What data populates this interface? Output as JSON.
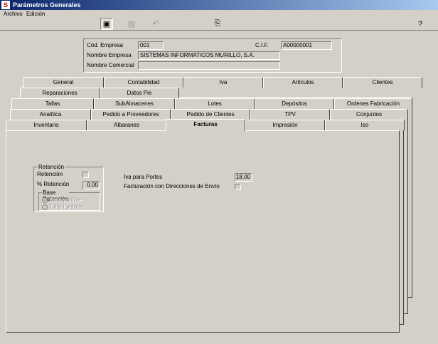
{
  "window": {
    "title": "Parámetros Generales"
  },
  "menu": {
    "archivo": "Archivo",
    "edicion": "Edición"
  },
  "toolbar": {
    "icons": [
      "save-exit-icon",
      "floppy-disk-icon",
      "undo-icon",
      "exit-door-icon",
      "help-icon"
    ]
  },
  "company": {
    "cod_label": "Cód. Empresa",
    "cod_value": "001",
    "cif_label": "C.I.F.",
    "cif_value": "A00000001",
    "name_label": "Nombre Empresa",
    "name_value": "SISTEMAS INFORMATICOS MURILLO, S.A.",
    "commercial_label": "Nombre Comercial",
    "commercial_value": ""
  },
  "tabs": {
    "row1": [
      "General",
      "Contabilidad",
      "Iva",
      "Artículos",
      "Clientes"
    ],
    "row2": [
      "Reparaciones",
      "Datos Pie"
    ],
    "row3": [
      "Tallas",
      "SubAlmacenes",
      "Lotes",
      "Depósitos",
      "Ordenes Fabricación"
    ],
    "row4": [
      "Analítica",
      "Pedido a Proveedores",
      "Pedido de Clientes",
      "TPV",
      "Conjuntos"
    ],
    "row5": [
      "Inventario",
      "Albaranes",
      "Facturas",
      "Impresión",
      "Iso"
    ],
    "active": "Facturas"
  },
  "retencion": {
    "group_title": "Retención",
    "retencion_label": "Retención",
    "porcentaje_label": "% Retención",
    "porcentaje_value": "0,00",
    "base_title": "Base Retención",
    "base_opt1": "Bª Imponible",
    "base_opt2": "Total Factura"
  },
  "portes": {
    "iva_label": "Iva para Portes",
    "iva_value": "18,00",
    "direcciones_label": "Facturación con Direcciones de Envío"
  }
}
